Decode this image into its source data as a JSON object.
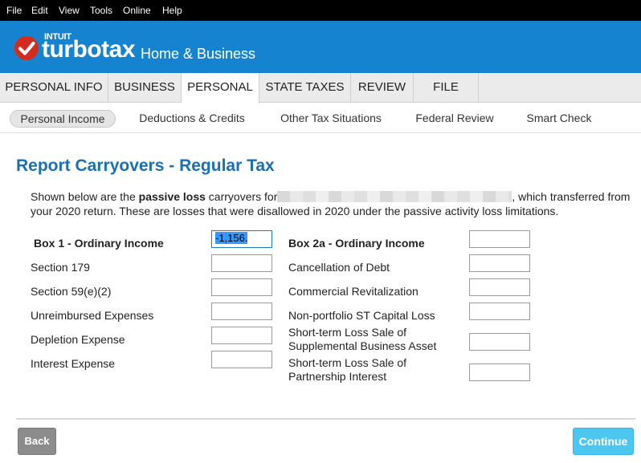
{
  "menu": [
    "File",
    "Edit",
    "View",
    "Tools",
    "Online",
    "Help"
  ],
  "brand": {
    "intuit": "INTUIT",
    "product": "turbotax",
    "edition": "Home & Business"
  },
  "tabs": [
    {
      "label": "PERSONAL INFO",
      "active": false
    },
    {
      "label": "BUSINESS",
      "active": false
    },
    {
      "label": "PERSONAL",
      "active": true
    },
    {
      "label": "STATE TAXES",
      "active": false
    },
    {
      "label": "REVIEW",
      "active": false
    },
    {
      "label": "FILE",
      "active": false
    }
  ],
  "subtabs": [
    {
      "label": "Personal Income",
      "active": true
    },
    {
      "label": "Deductions & Credits",
      "active": false
    },
    {
      "label": "Other Tax Situations",
      "active": false
    },
    {
      "label": "Federal Review",
      "active": false
    },
    {
      "label": "Smart Check",
      "active": false
    }
  ],
  "page": {
    "title": "Report Carryovers - Regular Tax",
    "intro_prefix": "Shown below are the ",
    "intro_bold": "passive loss",
    "intro_mid": " carryovers for",
    "intro_suffix": ", which transferred from your 2020 return. These are losses that were disallowed in 2020 under the passive activity loss limitations."
  },
  "left_fields": [
    {
      "label": "Box 1 - Ordinary Income",
      "bold": true,
      "value": "-1,156."
    },
    {
      "label": "Section 179",
      "bold": false,
      "value": ""
    },
    {
      "label": "Section 59(e)(2)",
      "bold": false,
      "value": ""
    },
    {
      "label": "Unreimbursed Expenses",
      "bold": false,
      "value": ""
    },
    {
      "label": "Depletion Expense",
      "bold": false,
      "value": ""
    },
    {
      "label": "Interest Expense",
      "bold": false,
      "value": ""
    }
  ],
  "right_fields": [
    {
      "label": "Box 2a - Ordinary Income",
      "bold": true,
      "value": ""
    },
    {
      "label": "Cancellation of Debt",
      "bold": false,
      "value": ""
    },
    {
      "label": "Commercial Revitalization",
      "bold": false,
      "value": ""
    },
    {
      "label": "Non-portfolio ST Capital Loss",
      "bold": false,
      "value": ""
    },
    {
      "label": "Short-term Loss Sale of",
      "label2": "Supplemental Business Asset",
      "bold": false,
      "value": ""
    },
    {
      "label": "Short-term Loss Sale of",
      "label2": "Partnership Interest",
      "bold": false,
      "value": ""
    }
  ],
  "buttons": {
    "back": "Back",
    "continue": "Continue"
  },
  "colors": {
    "menubar": "#000000",
    "banner": "#1683d0",
    "title": "#1a6fb5",
    "continue": "#4dc7f0",
    "back": "#8c8c8c",
    "logo_check": "#d52b1e"
  }
}
